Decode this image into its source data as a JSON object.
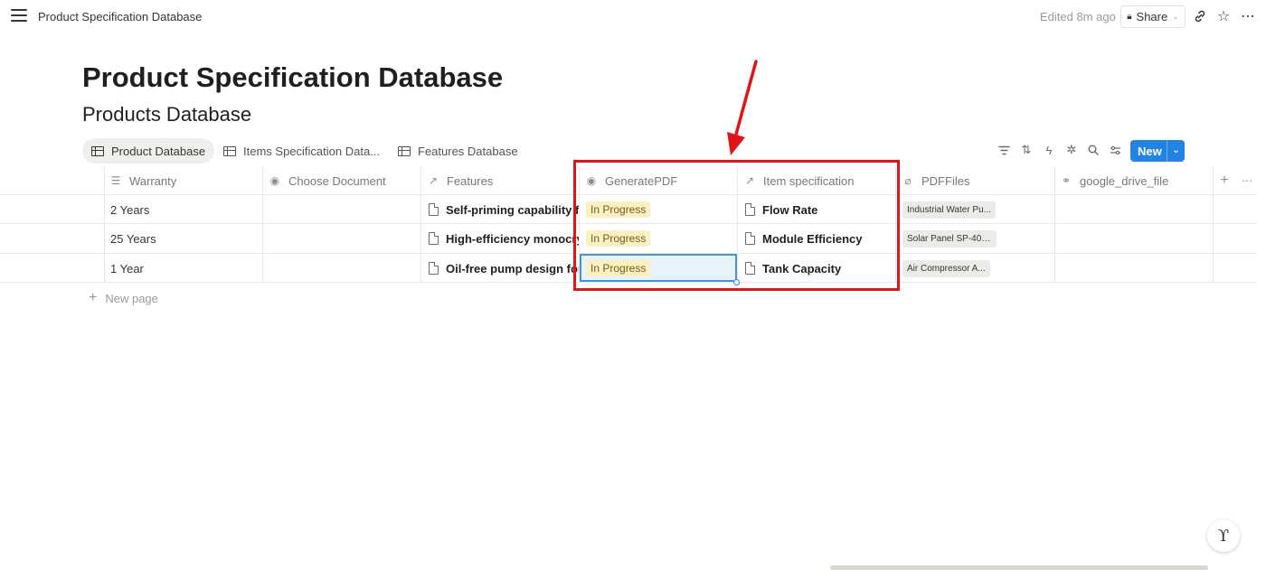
{
  "topbar": {
    "breadcrumb": "Product Specification Database",
    "edited": "Edited 8m ago",
    "share_label": "Share"
  },
  "page": {
    "title": "Product Specification Database",
    "database_title": "Products Database"
  },
  "tabs": [
    {
      "label": "Product Database",
      "active": true
    },
    {
      "label": "Items Specification Data...",
      "active": false
    },
    {
      "label": "Features Database",
      "active": false
    }
  ],
  "toolbar": {
    "new_label": "New",
    "icons": [
      "filter-icon",
      "sort-icon",
      "automation-icon",
      "ai-icon",
      "search-icon",
      "settings-icon"
    ]
  },
  "columns": [
    {
      "label": "Warranty",
      "icon": "text-icon"
    },
    {
      "label": "Choose Document",
      "icon": "select-icon"
    },
    {
      "label": "Features",
      "icon": "relation-icon"
    },
    {
      "label": "GeneratePDF",
      "icon": "select-icon"
    },
    {
      "label": "Item specification",
      "icon": "relation-icon"
    },
    {
      "label": "PDFFiles",
      "icon": "attachment-icon"
    },
    {
      "label": "google_drive_file",
      "icon": "link-icon"
    }
  ],
  "rows": [
    {
      "warranty": "2 Years",
      "features": "Self-priming capability fo",
      "generate_pdf": "In Progress",
      "item_spec": "Flow Rate",
      "pdf_file": "Industrial Water Pu..."
    },
    {
      "warranty": "25 Years",
      "features": "High-efficiency monocryst",
      "generate_pdf": "In Progress",
      "item_spec": "Module Efficiency",
      "pdf_file": "Solar Panel SP-400..."
    },
    {
      "warranty": "1 Year",
      "features": "Oil-free pump design for",
      "generate_pdf": "In Progress",
      "item_spec": "Tank Capacity",
      "pdf_file": "Air Compressor A..."
    }
  ],
  "new_page_label": "New page",
  "colors": {
    "accent": "#2383e2",
    "status_bg": "#fbf0c2",
    "annotation": "#e0141a"
  }
}
